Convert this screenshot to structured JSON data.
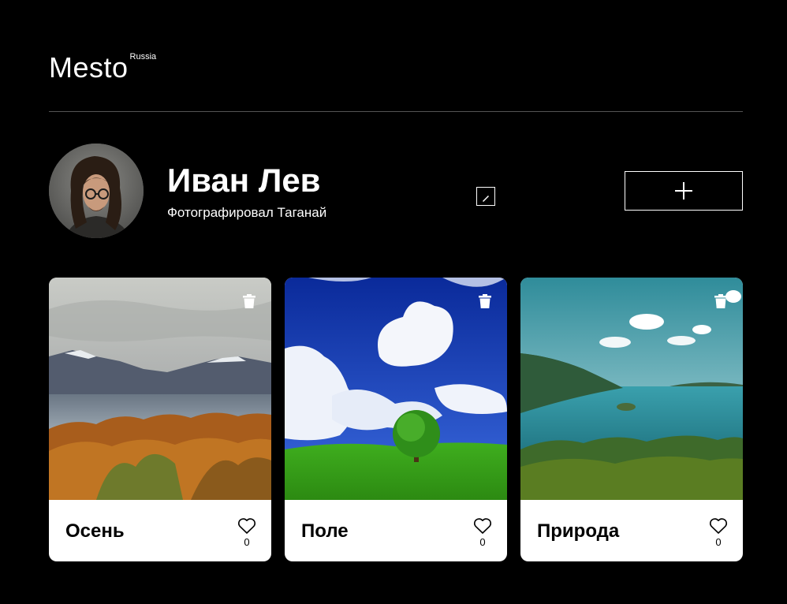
{
  "header": {
    "logo": "Mesto",
    "logo_sup": "Russia"
  },
  "profile": {
    "name": "Иван Лев",
    "about": "Фотографировал Таганай",
    "edit_icon": "pencil-icon",
    "add_icon": "plus-icon"
  },
  "cards": [
    {
      "title": "Осень",
      "likes": "0",
      "image": "autumn-lake-mountains-photo"
    },
    {
      "title": "Поле",
      "likes": "0",
      "image": "green-field-tree-clouds-photo"
    },
    {
      "title": "Природа",
      "likes": "0",
      "image": "turquoise-lake-forest-photo"
    }
  ],
  "icons": {
    "delete": "trash-icon",
    "like": "heart-icon"
  },
  "colors": {
    "background": "#000000",
    "card": "#ffffff",
    "divider": "#545454"
  }
}
